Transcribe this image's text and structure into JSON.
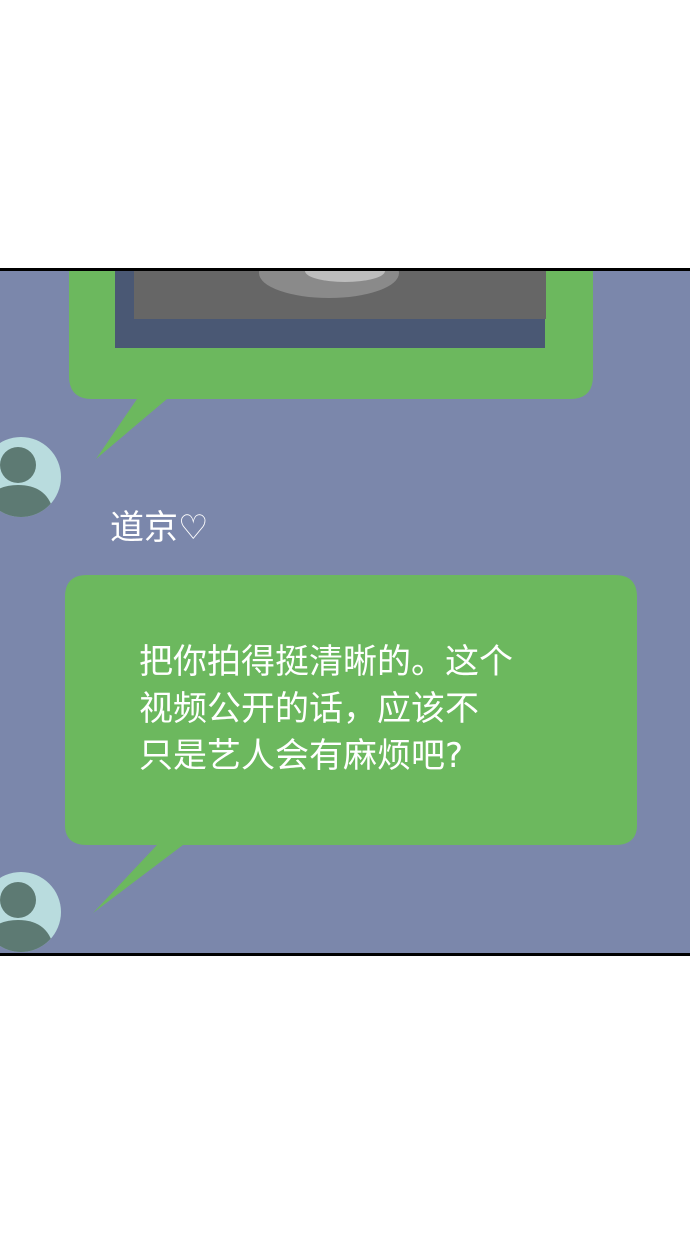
{
  "chat": {
    "sender_name": "道京♡",
    "message_lines": [
      "把你拍得挺清晰的。这个",
      "视频公开的话，应该不",
      "只是艺人会有麻烦吧?"
    ],
    "bubble_color": "#6cb85e",
    "background_color": "#7b87ab",
    "avatar_color": "#b9dcde",
    "avatar_silhouette_color": "#5d7a73"
  }
}
